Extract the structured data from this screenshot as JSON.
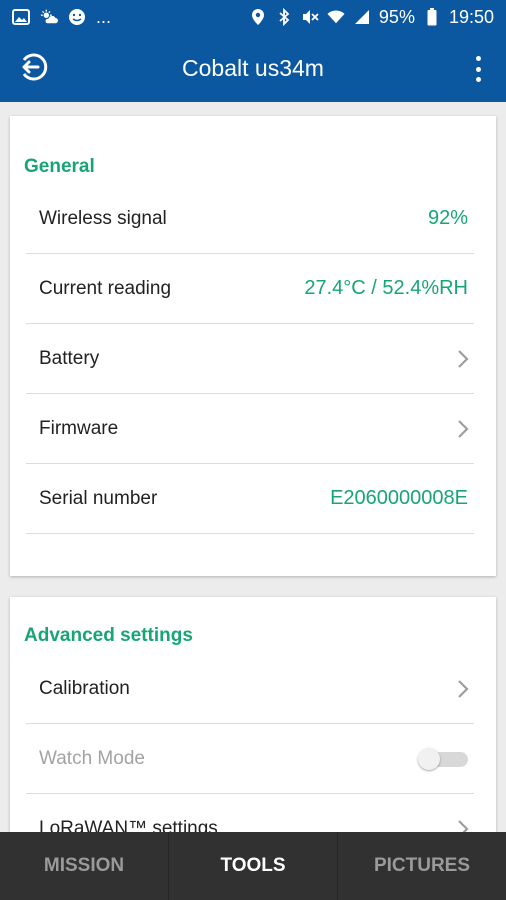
{
  "status_bar": {
    "battery": "95%",
    "time": "19:50",
    "left_icons": [
      "image-icon",
      "weather-icon",
      "smiley-icon"
    ],
    "more": "...",
    "right_icons": [
      "location-icon",
      "bluetooth-icon",
      "mute-icon",
      "wifi-icon",
      "signal-icon",
      "battery-icon"
    ]
  },
  "app_bar": {
    "title": "Cobalt us34m",
    "back_icon": "exit-icon",
    "menu_icon": "more-vertical-icon"
  },
  "general": {
    "title": "General",
    "rows": [
      {
        "label": "Wireless signal",
        "value": "92%"
      },
      {
        "label": "Current reading",
        "value": "27.4°C / 52.4%RH"
      },
      {
        "label": "Battery",
        "icon": "chevron-right-icon"
      },
      {
        "label": "Firmware",
        "icon": "chevron-right-icon"
      },
      {
        "label": "Serial number",
        "value": "E2060000008E"
      }
    ]
  },
  "advanced": {
    "title": "Advanced settings",
    "rows": [
      {
        "label": "Calibration",
        "icon": "chevron-right-icon"
      },
      {
        "label": "Watch Mode",
        "toggle": "off",
        "disabled": true
      },
      {
        "label": "LoRaWAN™ settings",
        "icon": "chevron-right-icon"
      }
    ]
  },
  "bottom_nav": {
    "tabs": [
      {
        "label": "MISSION",
        "active": false
      },
      {
        "label": "TOOLS",
        "active": true
      },
      {
        "label": "PICTURES",
        "active": false
      }
    ]
  },
  "colors": {
    "primary": "#0b57a0",
    "accent": "#17a673",
    "nav_bg": "#313131"
  }
}
